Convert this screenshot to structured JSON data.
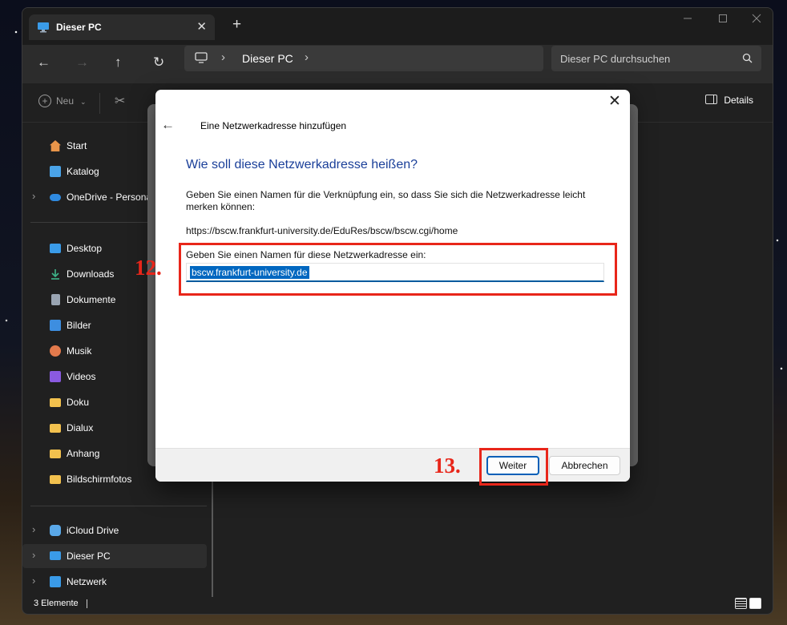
{
  "window": {
    "tab_title": "Dieser PC",
    "tab_icon": "monitor-icon",
    "close_tab": "✕",
    "new_tab": "+"
  },
  "nav": {
    "back": "←",
    "forward": "→",
    "up": "↑",
    "refresh": "↻",
    "address_location": "Dieser PC",
    "search_placeholder": "Dieser PC durchsuchen"
  },
  "toolbar": {
    "new_label": "Neu",
    "details_label": "Details"
  },
  "sidebar": {
    "items": [
      {
        "label": "Start",
        "icon": "home-icon",
        "color": "#e8954a"
      },
      {
        "label": "Katalog",
        "icon": "gallery-icon",
        "color": "#4aa3e8"
      },
      {
        "label": "OneDrive - Persona",
        "icon": "cloud-icon",
        "color": "#2f8ae0"
      },
      {
        "label": "Desktop",
        "icon": "desktop-icon",
        "color": "#3a9be8"
      },
      {
        "label": "Downloads",
        "icon": "download-icon",
        "color": "#3fb58a"
      },
      {
        "label": "Dokumente",
        "icon": "document-icon",
        "color": "#9aa5b3"
      },
      {
        "label": "Bilder",
        "icon": "picture-icon",
        "color": "#3d8ee0"
      },
      {
        "label": "Musik",
        "icon": "music-icon",
        "color": "#e37a4c"
      },
      {
        "label": "Videos",
        "icon": "video-icon",
        "color": "#8a5ae0"
      },
      {
        "label": "Doku",
        "icon": "folder-icon",
        "color": "#f2c14e"
      },
      {
        "label": "Dialux",
        "icon": "folder-icon",
        "color": "#f2c14e"
      },
      {
        "label": "Anhang",
        "icon": "folder-icon",
        "color": "#f2c14e"
      },
      {
        "label": "Bildschirmfotos",
        "icon": "folder-icon",
        "color": "#f2c14e"
      },
      {
        "label": "iCloud Drive",
        "icon": "icloud-icon",
        "color": "#5aa8e8"
      },
      {
        "label": "Dieser PC",
        "icon": "monitor-icon",
        "color": "#3a9be8"
      },
      {
        "label": "Netzwerk",
        "icon": "network-icon",
        "color": "#3a9be8"
      }
    ]
  },
  "status": {
    "item_count": "3 Elemente"
  },
  "dialog": {
    "title": "Eine Netzwerkadresse hinzufügen",
    "heading": "Wie soll diese Netzwerkadresse heißen?",
    "description": "Geben Sie einen Namen für die Verknüpfung ein, so dass Sie sich die Netzwerkadresse leicht merken können:",
    "url": "https://bscw.frankfurt-university.de/EduRes/bscw/bscw.cgi/home",
    "field_label": "Geben Sie einen Namen für diese Netzwerkadresse ein:",
    "field_value": "bscw.frankfurt-university.de",
    "next_button": "Weiter",
    "cancel_button": "Abbrechen"
  },
  "annotations": {
    "step12": "12.",
    "step13": "13.",
    "color": "#e8261a"
  }
}
